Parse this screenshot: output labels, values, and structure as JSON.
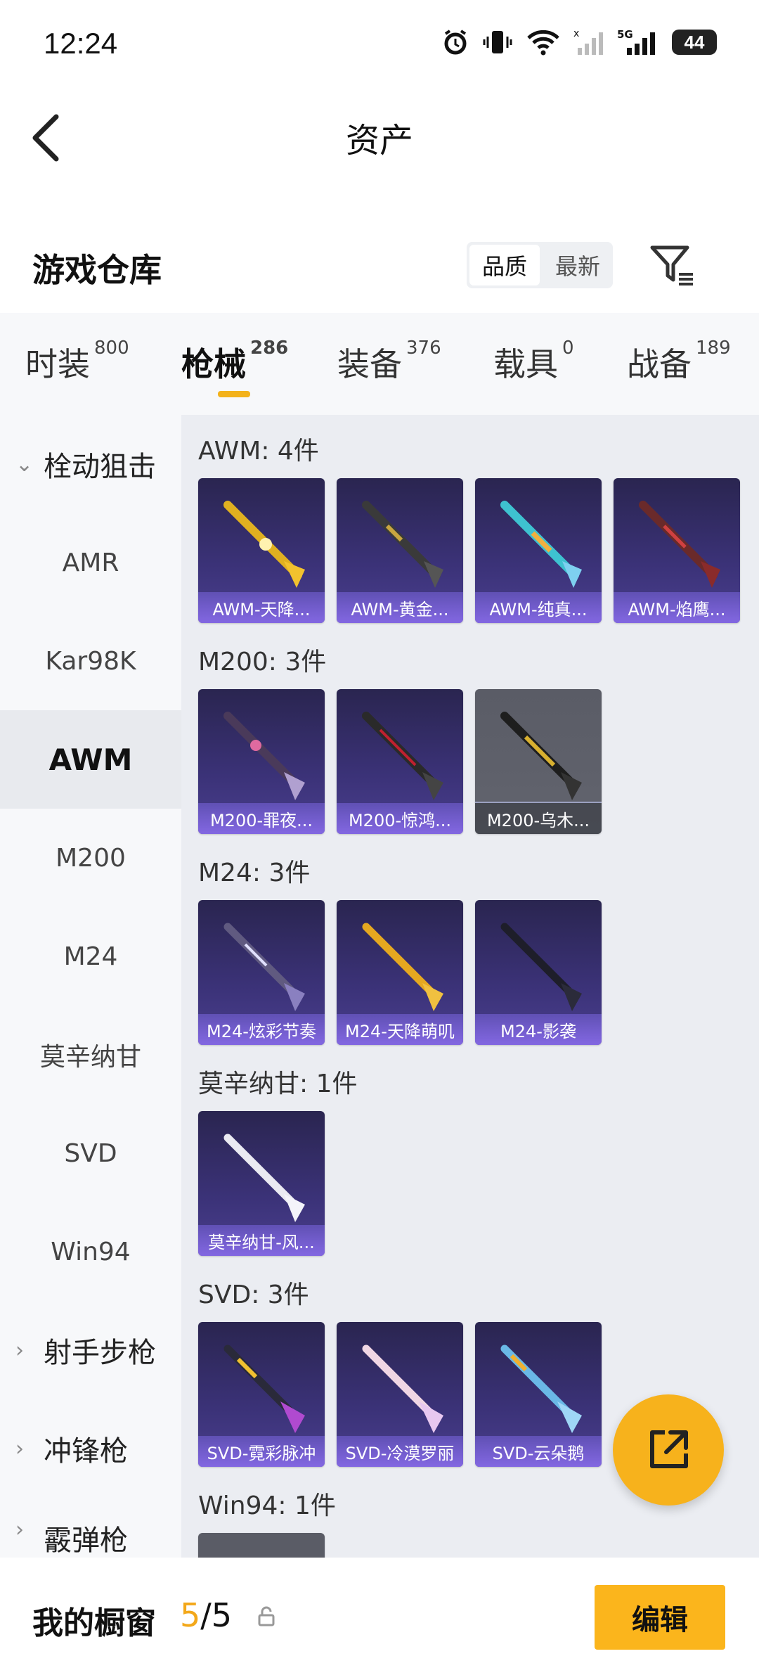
{
  "status_bar": {
    "time": "12:24",
    "battery": "44"
  },
  "header": {
    "title": "资产"
  },
  "warehouse": {
    "title": "游戏仓库",
    "sort_options": [
      "品质",
      "最新"
    ],
    "sort_selected": "品质"
  },
  "category_tabs": [
    {
      "label": "时装",
      "count": "800"
    },
    {
      "label": "枪械",
      "count": "286",
      "active": true
    },
    {
      "label": "装备",
      "count": "376"
    },
    {
      "label": "载具",
      "count": "0"
    },
    {
      "label": "战备",
      "count": "189"
    }
  ],
  "sidebar": {
    "group_open": "栓动狙击",
    "items": [
      "AMR",
      "Kar98K",
      "AWM",
      "M200",
      "M24",
      "莫辛纳甘",
      "SVD",
      "Win94"
    ],
    "selected": "AWM",
    "groups_closed": [
      "射手步枪",
      "冲锋枪",
      "霰弹枪"
    ]
  },
  "sections": [
    {
      "title": "AWM: 4件",
      "items": [
        "AWM-天降...",
        "AWM-黄金...",
        "AWM-纯真...",
        "AWM-焰鹰..."
      ]
    },
    {
      "title": "M200: 3件",
      "items": [
        "M200-罪夜...",
        "M200-惊鸿...",
        "M200-乌木..."
      ]
    },
    {
      "title": "M24: 3件",
      "items": [
        "M24-炫彩节奏",
        "M24-天降萌叽",
        "M24-影袭"
      ]
    },
    {
      "title": "莫辛纳甘: 1件",
      "items": [
        "莫辛纳甘-风..."
      ]
    },
    {
      "title": "SVD: 3件",
      "items": [
        "SVD-霓彩脉冲",
        "SVD-冷漠罗丽",
        "SVD-云朵鹅"
      ]
    },
    {
      "title": "Win94: 1件",
      "items": []
    }
  ],
  "bottom": {
    "showcase_label": "我的橱窗",
    "count_current": "5",
    "count_sep": "/",
    "count_total": "5",
    "edit_label": "编辑"
  },
  "colors": {
    "accent": "#f7b21c",
    "card_purple": "#3b3278"
  }
}
